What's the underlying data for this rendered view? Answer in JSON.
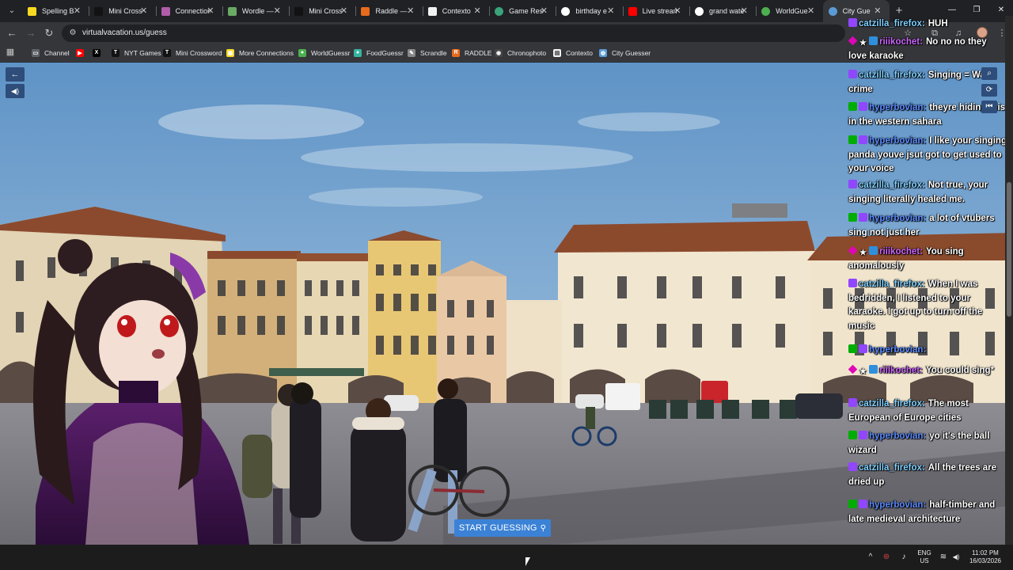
{
  "browser": {
    "tabs": [
      {
        "title": "Spelling B",
        "icon": "bee-icon",
        "color": "#f7da21",
        "close": "✕"
      },
      {
        "title": "Mini Cross",
        "icon": "nyt-icon",
        "color": "#121212",
        "close": "✕"
      },
      {
        "title": "Connection",
        "icon": "grid-icon",
        "color": "#b05ca8",
        "close": "✕"
      },
      {
        "title": "Wordle —",
        "icon": "wordle-icon",
        "color": "#6aaa64",
        "close": "✕"
      },
      {
        "title": "Mini Cross",
        "icon": "nyt-icon",
        "color": "#121212",
        "close": "✕"
      },
      {
        "title": "Raddle —",
        "icon": "raddle-icon",
        "color": "#e86a1c",
        "close": "✕"
      },
      {
        "title": "Contexto",
        "icon": "doc-icon",
        "color": "#f2f2f2",
        "close": "✕"
      },
      {
        "title": "Game Resu",
        "icon": "globe-icon",
        "color": "#3aa37a",
        "close": "✕"
      },
      {
        "title": "birthday e",
        "icon": "google-icon",
        "color": "#ffffff",
        "close": "✕"
      },
      {
        "title": "Live stream",
        "icon": "youtube-icon",
        "color": "#ff0000",
        "close": "✕"
      },
      {
        "title": "grand wate",
        "icon": "google-icon",
        "color": "#ffffff",
        "close": "✕"
      },
      {
        "title": "WorldGue",
        "icon": "globe-icon",
        "color": "#4caf50",
        "close": "✕"
      },
      {
        "title": "City Gue",
        "icon": "globe-icon",
        "color": "#5b9bd5",
        "close": "✕",
        "active": true
      }
    ],
    "tab_menu_glyph": "⌄",
    "new_tab_glyph": "+",
    "window": {
      "minimize": "—",
      "restore": "❐",
      "close": "✕"
    },
    "nav": {
      "back": "←",
      "forward": "→",
      "reload": "↻",
      "site_info": "⚙"
    },
    "url": "virtualvacation.us/guess",
    "toolbar_icons": {
      "star": "☆",
      "extensions": "⧉",
      "media": "♫",
      "menu": "⋮"
    },
    "apps_glyph": "▦",
    "bookmarks": [
      {
        "label": "Channel",
        "icon": "folder-icon",
        "color": "#5f6368",
        "glyph": "▭"
      },
      {
        "label": "",
        "icon": "youtube-icon",
        "color": "#ff0000",
        "glyph": "▶"
      },
      {
        "label": "",
        "icon": "x-icon",
        "color": "#000000",
        "glyph": "X"
      },
      {
        "label": "NYT Games",
        "icon": "nyt-icon",
        "color": "#121212",
        "glyph": "T"
      },
      {
        "label": "Mini Crossword",
        "icon": "nyt-icon",
        "color": "#121212",
        "glyph": "T"
      },
      {
        "label": "More Connections",
        "icon": "grid-icon",
        "color": "#f7da21",
        "glyph": "▦"
      },
      {
        "label": "WorldGuessr",
        "icon": "globe-icon",
        "color": "#4caf50",
        "glyph": "●"
      },
      {
        "label": "FoodGuessr",
        "icon": "globe-icon",
        "color": "#37b5a0",
        "glyph": "●"
      },
      {
        "label": "Scrandle",
        "icon": "scrandle-icon",
        "color": "#888888",
        "glyph": "✎"
      },
      {
        "label": "RADDLE",
        "icon": "raddle-icon",
        "color": "#e86a1c",
        "glyph": "R"
      },
      {
        "label": "Chronophoto",
        "icon": "camera-icon",
        "color": "#444444",
        "glyph": "◉"
      },
      {
        "label": "Contexto",
        "icon": "doc-icon",
        "color": "#f2f2f2",
        "glyph": "▤"
      },
      {
        "label": "City Guesser",
        "icon": "globe-icon",
        "color": "#5b9bd5",
        "glyph": "◍"
      }
    ]
  },
  "game": {
    "back_glyph": "←",
    "sound_glyph": "◀)",
    "zoom_glyph": "⌕",
    "refresh_glyph": "⟳",
    "restart_glyph": "⏮",
    "start_label": "START GUESSING",
    "start_pin": "⚲"
  },
  "chat": [
    {
      "badges": [
        "sub"
      ],
      "user": "catzilla_firefox:",
      "color": "#7fd0ff",
      "text": "HUH"
    },
    {
      "badges": [
        "vip",
        "star",
        "blue"
      ],
      "user": "riiikochet:",
      "color": "#cc66ff",
      "text": "No no no they love karaoke"
    },
    {
      "badges": [
        "sub"
      ],
      "user": "catzilla_firefox:",
      "color": "#7fd0ff",
      "text": "Singing = War crime"
    },
    {
      "badges": [
        "mod",
        "sub"
      ],
      "user": "hyperbovian:",
      "color": "#5b8cff",
      "text": "theyre hiding this in the western sahara"
    },
    {
      "badges": [
        "mod",
        "sub"
      ],
      "user": "hyperbovian:",
      "color": "#5b8cff",
      "text": "I like your singing panda youve jsut got to get used to your voice"
    },
    {
      "badges": [
        "sub"
      ],
      "user": "catzilla_firefox:",
      "color": "#7fd0ff",
      "text": "Not true, your singing literally healed me."
    },
    {
      "badges": [
        "mod",
        "sub"
      ],
      "user": "hyperbovian:",
      "color": "#5b8cff",
      "text": "a lot of vtubers sing not just her"
    },
    {
      "badges": [
        "vip",
        "star",
        "blue"
      ],
      "user": "riiikochet:",
      "color": "#cc66ff",
      "text": "You sing anomalously"
    },
    {
      "badges": [
        "sub"
      ],
      "user": "catzilla_firefox:",
      "color": "#7fd0ff",
      "text": "When I was bedridden, I listened to your karaoke. I got up to turn off the music"
    },
    {
      "badges": [
        "mod",
        "sub"
      ],
      "user": "hyperbovian:",
      "color": "#5b8cff",
      "text": ""
    },
    {
      "badges": [
        "vip",
        "star",
        "blue"
      ],
      "user": "riiikochet:",
      "color": "#cc66ff",
      "text": "You could sing*"
    },
    {
      "badges": [
        "sub"
      ],
      "user": "catzilla_firefox:",
      "color": "#7fd0ff",
      "text": "The most European of Europe cities"
    },
    {
      "badges": [
        "mod",
        "sub"
      ],
      "user": "hyperbovian:",
      "color": "#5b8cff",
      "text": "yo it's the ball wizard"
    },
    {
      "badges": [
        "sub"
      ],
      "user": "catzilla_firefox:",
      "color": "#7fd0ff",
      "text": "All the trees are dried up"
    },
    {
      "badges": [
        "mod",
        "sub"
      ],
      "user": "hyperbovian:",
      "color": "#5b8cff",
      "text": "half-timber and late medieval architecture"
    }
  ],
  "taskbar": {
    "chevron": "^",
    "lang_top": "ENG",
    "lang_bottom": "US",
    "time": "11:02 PM",
    "date": "16/03/2026",
    "wifi": "≋",
    "volume": "◀)",
    "mic": "♪",
    "steam": "⊛"
  }
}
